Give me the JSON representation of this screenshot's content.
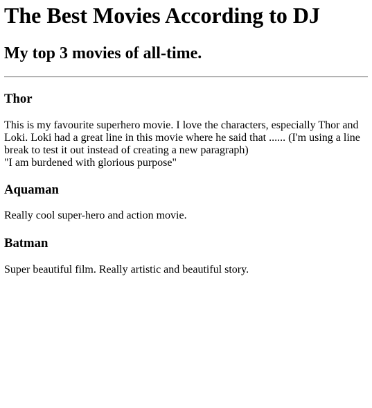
{
  "page": {
    "title": "The Best Movies According to DJ",
    "subtitle": "My top 3 movies of all-time."
  },
  "movies": [
    {
      "name": "Thor",
      "description_line1": "This is my favourite superhero movie. I love the characters, especially Thor and Loki. Loki had a great line in this movie where he said that ...... (I'm using a line break to test it out instead of creating a new paragraph)",
      "description_line2": "\"I am burdened with glorious purpose\""
    },
    {
      "name": "Aquaman",
      "description": "Really cool super-hero and action movie."
    },
    {
      "name": "Batman",
      "description": "Super beautiful film. Really artistic and beautiful story."
    }
  ]
}
